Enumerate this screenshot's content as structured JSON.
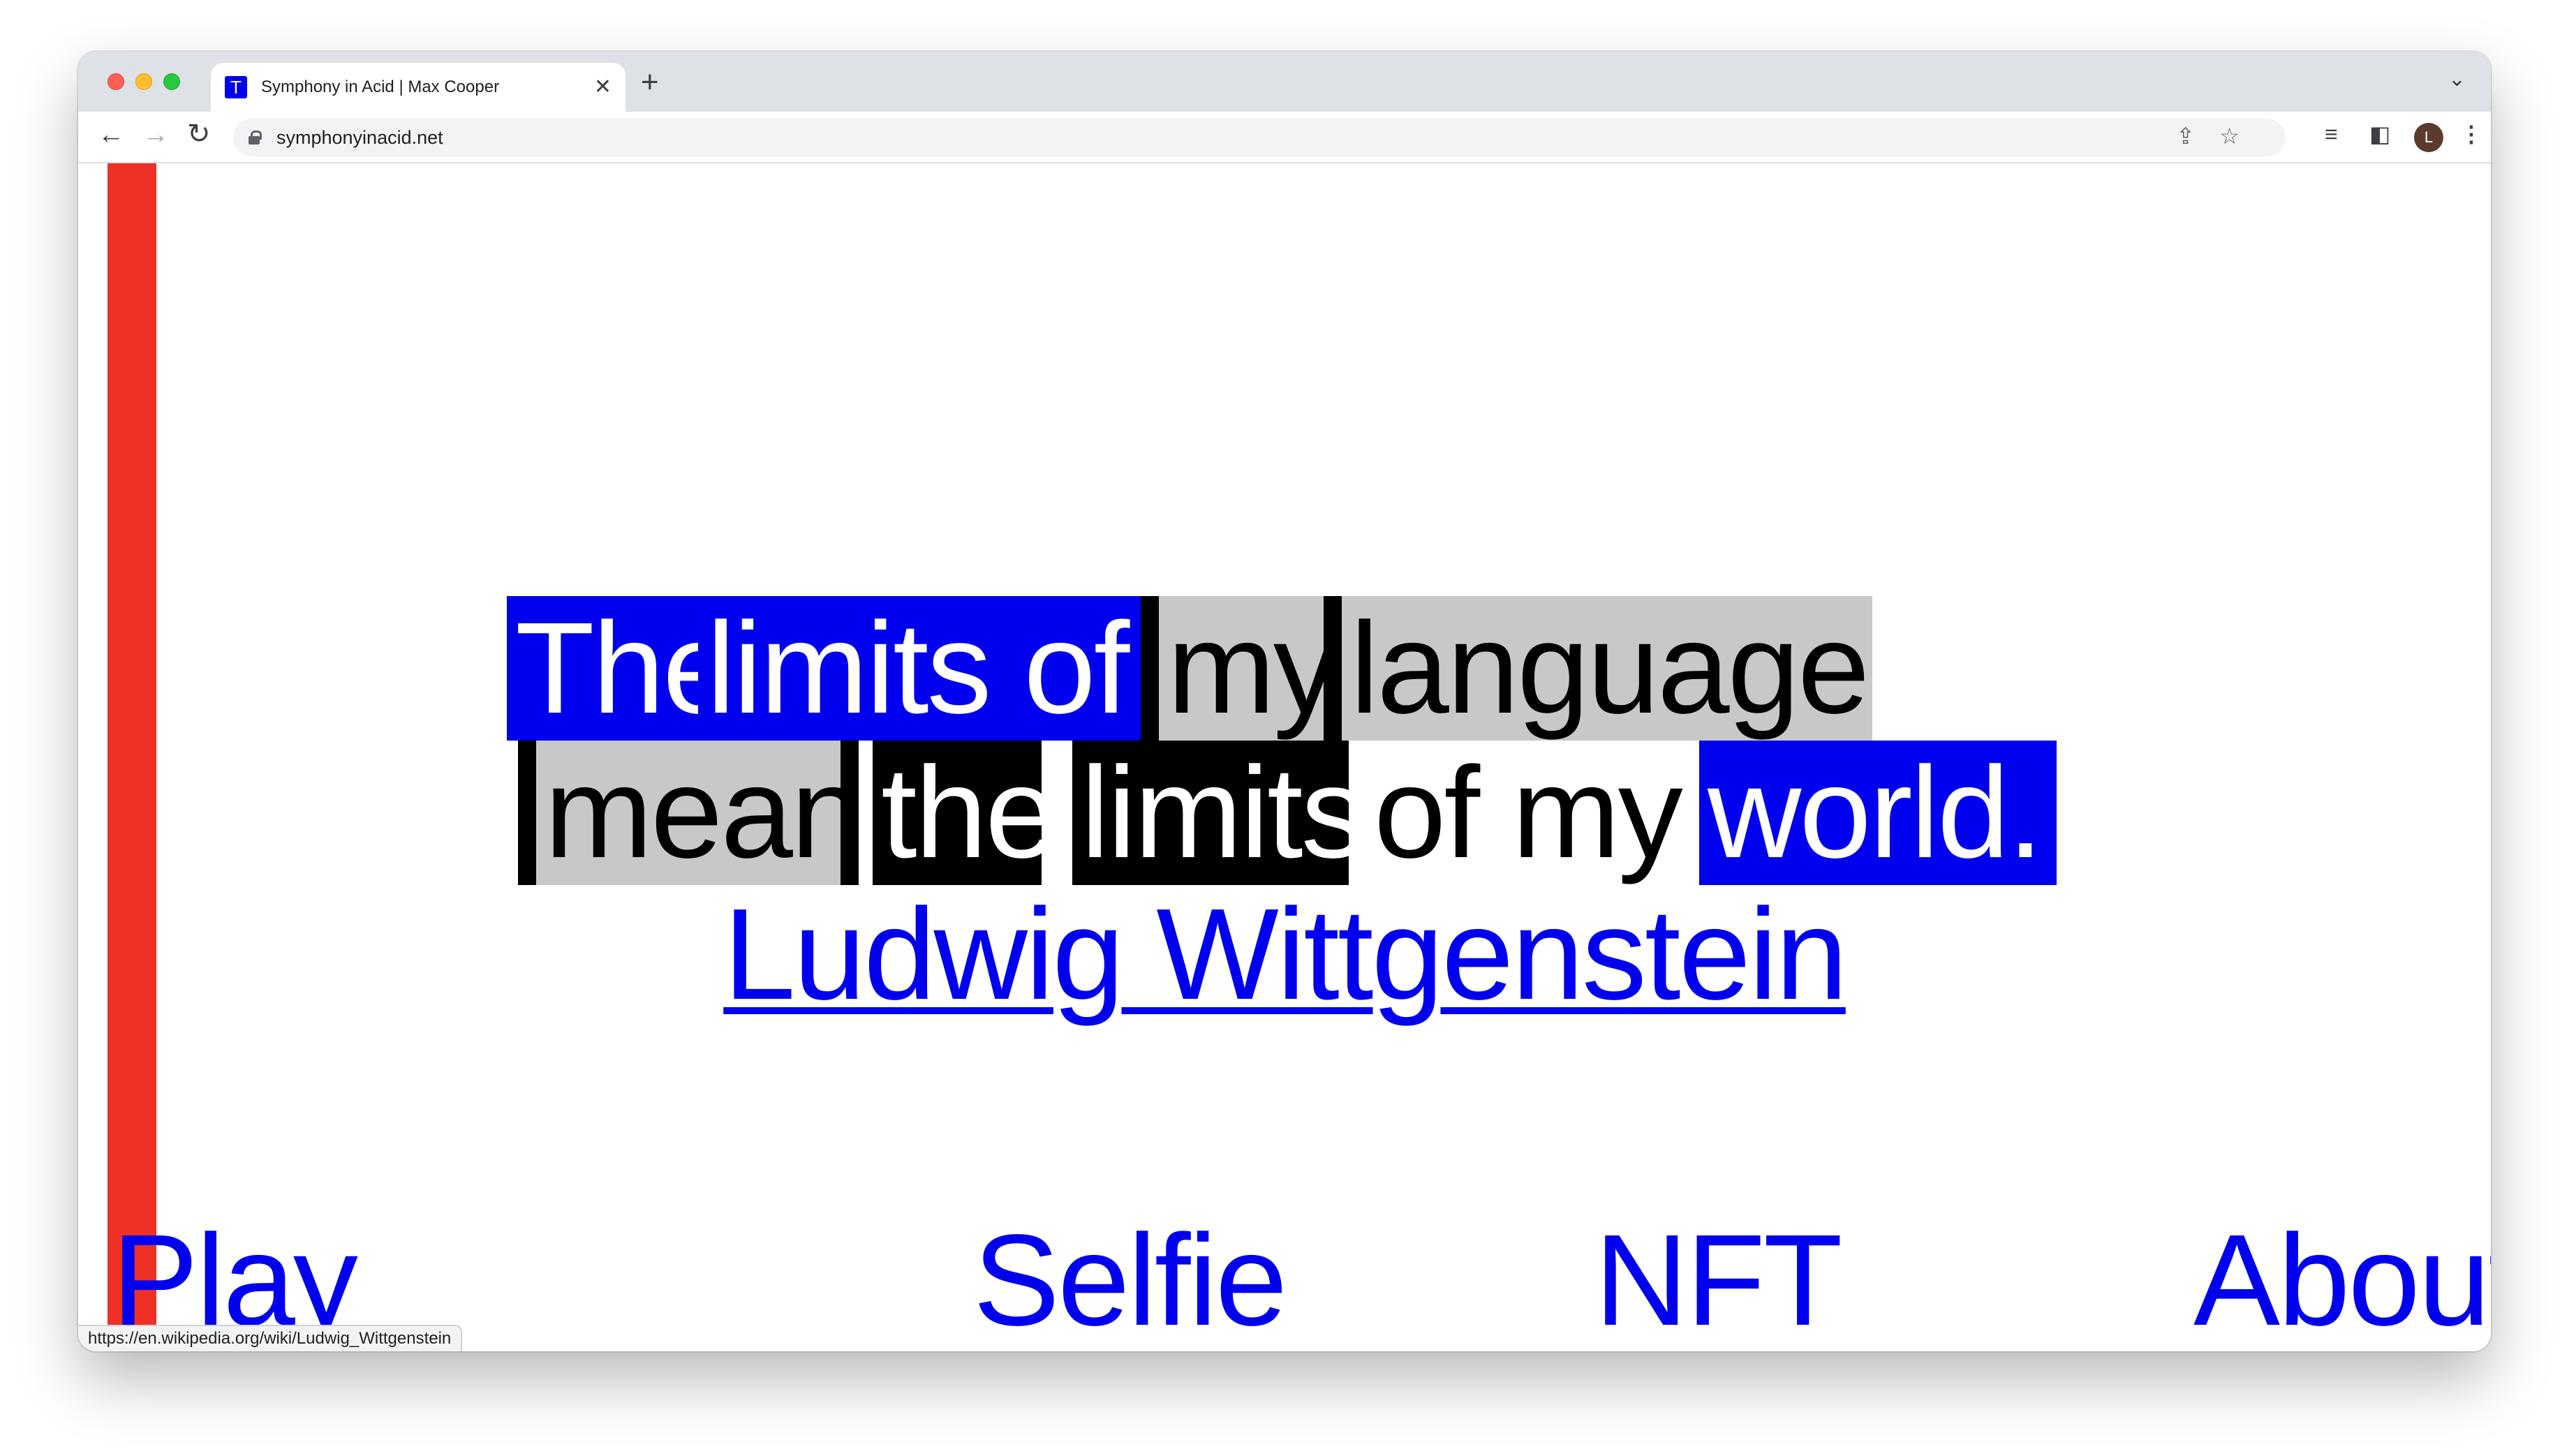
{
  "browser": {
    "tab_title": "Symphony in Acid | Max Cooper",
    "tab_favicon_letter": "T",
    "new_tab": "+",
    "close": "✕",
    "tab_menu": "⌄",
    "url": "symphonyinacid.net",
    "avatar_letter": "L",
    "icons": {
      "back": "arrow-left-icon",
      "forward": "arrow-right-icon",
      "reload": "reload-icon",
      "lock": "lock-icon",
      "share": "share-icon",
      "bookmark": "star-icon",
      "media": "media-controls-icon",
      "side_panel": "side-panel-icon",
      "menu": "kebab-menu-icon"
    }
  },
  "quote": {
    "line1": [
      {
        "text": "The",
        "style": "blue"
      },
      {
        "text": "limits of",
        "style": "blue"
      },
      {
        "text": "my",
        "style": "grey"
      },
      {
        "text": "language",
        "style": "grey"
      }
    ],
    "line2": [
      {
        "text": "mean",
        "style": "grey"
      },
      {
        "text": "the",
        "style": "black"
      },
      {
        "text": "limits",
        "style": "black"
      },
      {
        "text": "of my",
        "style": "plain"
      },
      {
        "text": "world.",
        "style": "blue"
      }
    ],
    "author": "Ludwig Wittgenstein"
  },
  "nav": {
    "play": "Play",
    "selfie": "Selfie",
    "nft": "NFT",
    "about": "About"
  },
  "status_bar_url": "https://en.wikipedia.org/wiki/Ludwig_Wittgenstein",
  "colors": {
    "link_blue": "#0000ee",
    "accent_red": "#ee3124",
    "highlight_grey": "#c8c8c8",
    "highlight_black": "#000000"
  }
}
